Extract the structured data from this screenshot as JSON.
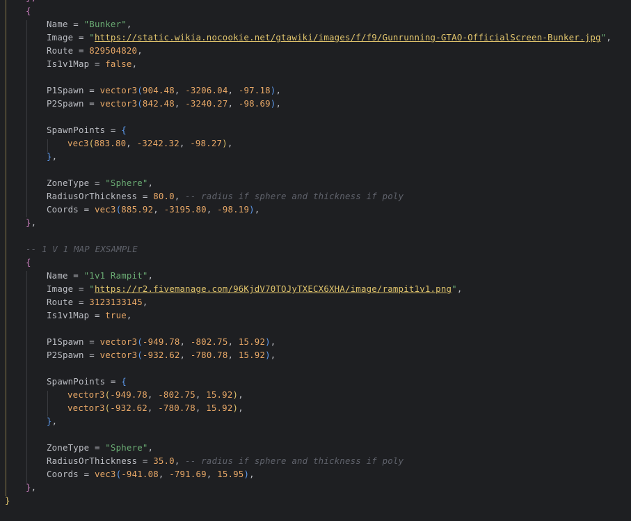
{
  "colors": {
    "background": "#1e1f22",
    "text": "#bcbec4",
    "string": "#6aab73",
    "number": "#e8a867",
    "keyword": "#e8a867",
    "function": "#e8a867",
    "comment": "#5f626b",
    "bracket_level1": "#e0c46c",
    "bracket_level2": "#c77dbb",
    "bracket_level3": "#5e9cf0",
    "indent_guide": "#3a3b3f"
  },
  "editor": {
    "lines": [
      {
        "tokens": [
          {
            "t": "},",
            "c": "t-b2"
          }
        ]
      },
      {
        "tokens": [
          {
            "t": "{",
            "c": "t-b2"
          }
        ]
      },
      {
        "tokens": [
          {
            "t": "Name = ",
            "c": "t-default"
          },
          {
            "t": "\"Bunker\"",
            "c": "t-str"
          },
          {
            "t": ",",
            "c": "t-punc"
          }
        ]
      },
      {
        "tokens": [
          {
            "t": "Image = ",
            "c": "t-default"
          },
          {
            "t": "\"",
            "c": "t-str"
          },
          {
            "t": "https://static.wikia.nocookie.net/gtawiki/images/f/f9/Gunrunning-GTAO-OfficialScreen-Bunker.jpg",
            "c": "t-url"
          },
          {
            "t": "\"",
            "c": "t-str"
          },
          {
            "t": ",",
            "c": "t-punc"
          }
        ]
      },
      {
        "tokens": [
          {
            "t": "Route = ",
            "c": "t-default"
          },
          {
            "t": "829504820",
            "c": "t-num"
          },
          {
            "t": ",",
            "c": "t-punc"
          }
        ]
      },
      {
        "tokens": [
          {
            "t": "Is1v1Map = ",
            "c": "t-default"
          },
          {
            "t": "false",
            "c": "t-kw"
          },
          {
            "t": ",",
            "c": "t-punc"
          }
        ]
      },
      {
        "tokens": []
      },
      {
        "tokens": [
          {
            "t": "P1Spawn = ",
            "c": "t-default"
          },
          {
            "t": "vector3",
            "c": "t-fn"
          },
          {
            "t": "(",
            "c": "t-b3"
          },
          {
            "t": "904.48",
            "c": "t-num"
          },
          {
            "t": ", ",
            "c": "t-punc"
          },
          {
            "t": "-3206.04",
            "c": "t-num"
          },
          {
            "t": ", ",
            "c": "t-punc"
          },
          {
            "t": "-97.18",
            "c": "t-num"
          },
          {
            "t": ")",
            "c": "t-b3"
          },
          {
            "t": ",",
            "c": "t-punc"
          }
        ]
      },
      {
        "tokens": [
          {
            "t": "P2Spawn = ",
            "c": "t-default"
          },
          {
            "t": "vector3",
            "c": "t-fn"
          },
          {
            "t": "(",
            "c": "t-b3"
          },
          {
            "t": "842.48",
            "c": "t-num"
          },
          {
            "t": ", ",
            "c": "t-punc"
          },
          {
            "t": "-3240.27",
            "c": "t-num"
          },
          {
            "t": ", ",
            "c": "t-punc"
          },
          {
            "t": "-98.69",
            "c": "t-num"
          },
          {
            "t": ")",
            "c": "t-b3"
          },
          {
            "t": ",",
            "c": "t-punc"
          }
        ]
      },
      {
        "tokens": []
      },
      {
        "tokens": [
          {
            "t": "SpawnPoints = ",
            "c": "t-default"
          },
          {
            "t": "{",
            "c": "t-b3"
          }
        ]
      },
      {
        "tokens": [
          {
            "t": "vec3",
            "c": "t-fn"
          },
          {
            "t": "(",
            "c": "t-b1"
          },
          {
            "t": "883.80",
            "c": "t-num"
          },
          {
            "t": ", ",
            "c": "t-punc"
          },
          {
            "t": "-3242.32",
            "c": "t-num"
          },
          {
            "t": ", ",
            "c": "t-punc"
          },
          {
            "t": "-98.27",
            "c": "t-num"
          },
          {
            "t": ")",
            "c": "t-b1"
          },
          {
            "t": ",",
            "c": "t-punc"
          }
        ]
      },
      {
        "tokens": [
          {
            "t": "}",
            "c": "t-b3"
          },
          {
            "t": ",",
            "c": "t-punc"
          }
        ]
      },
      {
        "tokens": []
      },
      {
        "tokens": [
          {
            "t": "ZoneType = ",
            "c": "t-default"
          },
          {
            "t": "\"Sphere\"",
            "c": "t-str"
          },
          {
            "t": ",",
            "c": "t-punc"
          }
        ]
      },
      {
        "tokens": [
          {
            "t": "RadiusOrThickness = ",
            "c": "t-default"
          },
          {
            "t": "80.0",
            "c": "t-num"
          },
          {
            "t": ", ",
            "c": "t-punc"
          },
          {
            "t": "-- radius if sphere and thickness if poly",
            "c": "t-comment"
          }
        ]
      },
      {
        "tokens": [
          {
            "t": "Coords = ",
            "c": "t-default"
          },
          {
            "t": "vec3",
            "c": "t-fn"
          },
          {
            "t": "(",
            "c": "t-b3"
          },
          {
            "t": "885.92",
            "c": "t-num"
          },
          {
            "t": ", ",
            "c": "t-punc"
          },
          {
            "t": "-3195.80",
            "c": "t-num"
          },
          {
            "t": ", ",
            "c": "t-punc"
          },
          {
            "t": "-98.19",
            "c": "t-num"
          },
          {
            "t": ")",
            "c": "t-b3"
          },
          {
            "t": ",",
            "c": "t-punc"
          }
        ]
      },
      {
        "tokens": [
          {
            "t": "}",
            "c": "t-b2"
          },
          {
            "t": ",",
            "c": "t-punc"
          }
        ]
      },
      {
        "tokens": []
      },
      {
        "tokens": [
          {
            "t": "-- 1 V 1 MAP EXSAMPLE",
            "c": "t-comment"
          }
        ]
      },
      {
        "tokens": [
          {
            "t": "{",
            "c": "t-b2"
          }
        ]
      },
      {
        "tokens": [
          {
            "t": "Name = ",
            "c": "t-default"
          },
          {
            "t": "\"1v1 Rampit\"",
            "c": "t-str"
          },
          {
            "t": ",",
            "c": "t-punc"
          }
        ]
      },
      {
        "tokens": [
          {
            "t": "Image = ",
            "c": "t-default"
          },
          {
            "t": "\"",
            "c": "t-str"
          },
          {
            "t": "https://r2.fivemanage.com/96KjdV70TOJyTXECX6XHA/image/rampit1v1.png",
            "c": "t-url"
          },
          {
            "t": "\"",
            "c": "t-str"
          },
          {
            "t": ",",
            "c": "t-punc"
          }
        ]
      },
      {
        "tokens": [
          {
            "t": "Route = ",
            "c": "t-default"
          },
          {
            "t": "3123133145",
            "c": "t-num"
          },
          {
            "t": ",",
            "c": "t-punc"
          }
        ]
      },
      {
        "tokens": [
          {
            "t": "Is1v1Map = ",
            "c": "t-default"
          },
          {
            "t": "true",
            "c": "t-kw"
          },
          {
            "t": ",",
            "c": "t-punc"
          }
        ]
      },
      {
        "tokens": []
      },
      {
        "tokens": [
          {
            "t": "P1Spawn = ",
            "c": "t-default"
          },
          {
            "t": "vector3",
            "c": "t-fn"
          },
          {
            "t": "(",
            "c": "t-b3"
          },
          {
            "t": "-949.78",
            "c": "t-num"
          },
          {
            "t": ", ",
            "c": "t-punc"
          },
          {
            "t": "-802.75",
            "c": "t-num"
          },
          {
            "t": ", ",
            "c": "t-punc"
          },
          {
            "t": "15.92",
            "c": "t-num"
          },
          {
            "t": ")",
            "c": "t-b3"
          },
          {
            "t": ",",
            "c": "t-punc"
          }
        ]
      },
      {
        "tokens": [
          {
            "t": "P2Spawn = ",
            "c": "t-default"
          },
          {
            "t": "vector3",
            "c": "t-fn"
          },
          {
            "t": "(",
            "c": "t-b3"
          },
          {
            "t": "-932.62",
            "c": "t-num"
          },
          {
            "t": ", ",
            "c": "t-punc"
          },
          {
            "t": "-780.78",
            "c": "t-num"
          },
          {
            "t": ", ",
            "c": "t-punc"
          },
          {
            "t": "15.92",
            "c": "t-num"
          },
          {
            "t": ")",
            "c": "t-b3"
          },
          {
            "t": ",",
            "c": "t-punc"
          }
        ]
      },
      {
        "tokens": []
      },
      {
        "tokens": [
          {
            "t": "SpawnPoints = ",
            "c": "t-default"
          },
          {
            "t": "{",
            "c": "t-b3"
          }
        ]
      },
      {
        "tokens": [
          {
            "t": "vector3",
            "c": "t-fn"
          },
          {
            "t": "(",
            "c": "t-b1"
          },
          {
            "t": "-949.78",
            "c": "t-num"
          },
          {
            "t": ", ",
            "c": "t-punc"
          },
          {
            "t": "-802.75",
            "c": "t-num"
          },
          {
            "t": ", ",
            "c": "t-punc"
          },
          {
            "t": "15.92",
            "c": "t-num"
          },
          {
            "t": ")",
            "c": "t-b1"
          },
          {
            "t": ",",
            "c": "t-punc"
          }
        ]
      },
      {
        "tokens": [
          {
            "t": "vector3",
            "c": "t-fn"
          },
          {
            "t": "(",
            "c": "t-b1"
          },
          {
            "t": "-932.62",
            "c": "t-num"
          },
          {
            "t": ", ",
            "c": "t-punc"
          },
          {
            "t": "-780.78",
            "c": "t-num"
          },
          {
            "t": ", ",
            "c": "t-punc"
          },
          {
            "t": "15.92",
            "c": "t-num"
          },
          {
            "t": ")",
            "c": "t-b1"
          },
          {
            "t": ",",
            "c": "t-punc"
          }
        ]
      },
      {
        "tokens": [
          {
            "t": "}",
            "c": "t-b3"
          },
          {
            "t": ",",
            "c": "t-punc"
          }
        ]
      },
      {
        "tokens": []
      },
      {
        "tokens": [
          {
            "t": "ZoneType = ",
            "c": "t-default"
          },
          {
            "t": "\"Sphere\"",
            "c": "t-str"
          },
          {
            "t": ",",
            "c": "t-punc"
          }
        ]
      },
      {
        "tokens": [
          {
            "t": "RadiusOrThickness = ",
            "c": "t-default"
          },
          {
            "t": "35.0",
            "c": "t-num"
          },
          {
            "t": ", ",
            "c": "t-punc"
          },
          {
            "t": "-- radius if sphere and thickness if poly",
            "c": "t-comment"
          }
        ]
      },
      {
        "tokens": [
          {
            "t": "Coords = ",
            "c": "t-default"
          },
          {
            "t": "vec3",
            "c": "t-fn"
          },
          {
            "t": "(",
            "c": "t-b3"
          },
          {
            "t": "-941.08",
            "c": "t-num"
          },
          {
            "t": ", ",
            "c": "t-punc"
          },
          {
            "t": "-791.69",
            "c": "t-num"
          },
          {
            "t": ", ",
            "c": "t-punc"
          },
          {
            "t": "15.95",
            "c": "t-num"
          },
          {
            "t": ")",
            "c": "t-b3"
          },
          {
            "t": ",",
            "c": "t-punc"
          }
        ]
      },
      {
        "tokens": [
          {
            "t": "}",
            "c": "t-b2"
          },
          {
            "t": ",",
            "c": "t-punc"
          }
        ]
      },
      {
        "tokens": [
          {
            "t": "}",
            "c": "t-b1"
          }
        ]
      }
    ]
  }
}
